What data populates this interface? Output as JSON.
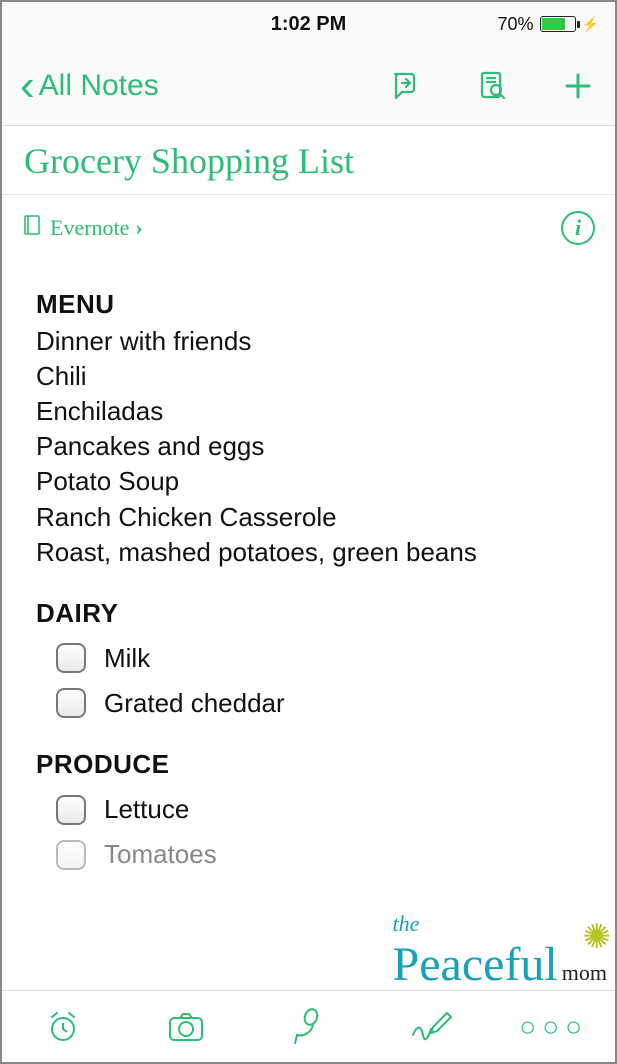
{
  "status": {
    "time": "1:02 PM",
    "battery_pct": "70%"
  },
  "nav": {
    "back_label": "All Notes"
  },
  "note": {
    "title": "Grocery Shopping List",
    "notebook": "Evernote"
  },
  "sections": {
    "menu": {
      "heading": "MENU",
      "items": [
        "Dinner with friends",
        "Chili",
        "Enchiladas",
        "Pancakes and eggs",
        "Potato Soup",
        "Ranch Chicken Casserole",
        "Roast, mashed potatoes, green beans"
      ]
    },
    "dairy": {
      "heading": "DAIRY",
      "items": [
        "Milk",
        "Grated cheddar"
      ]
    },
    "produce": {
      "heading": "PRODUCE",
      "items": [
        "Lettuce",
        "Tomatoes"
      ]
    }
  },
  "watermark": {
    "the": "the",
    "peaceful": "Peaceful",
    "mom": "mom"
  }
}
